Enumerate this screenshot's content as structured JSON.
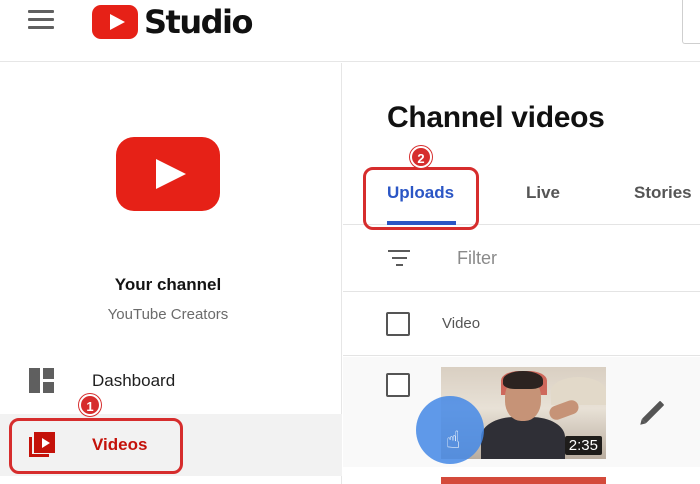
{
  "header": {
    "menu_icon": "hamburger-icon",
    "logo_text": "Studio"
  },
  "sidebar": {
    "channel_title": "Your channel",
    "channel_subtitle": "YouTube Creators",
    "items": [
      {
        "label": "Dashboard",
        "icon": "dashboard-icon",
        "selected": false
      },
      {
        "label": "Videos",
        "icon": "videos-icon",
        "selected": true
      }
    ]
  },
  "annotations": {
    "step1": "1",
    "step2": "2",
    "highlight_color": "#d62d2d"
  },
  "main": {
    "title": "Channel videos",
    "tabs": [
      {
        "label": "Uploads",
        "active": true
      },
      {
        "label": "Live",
        "active": false
      },
      {
        "label": "Stories",
        "active": false
      }
    ],
    "filter": {
      "placeholder": "Filter",
      "icon": "filter-icon"
    },
    "table": {
      "column_video": "Video",
      "rows": [
        {
          "duration": "2:35"
        }
      ]
    }
  },
  "colors": {
    "brand_red": "#e62117",
    "active_tab_blue": "#2b56c5",
    "selected_nav_red": "#c4120a"
  }
}
